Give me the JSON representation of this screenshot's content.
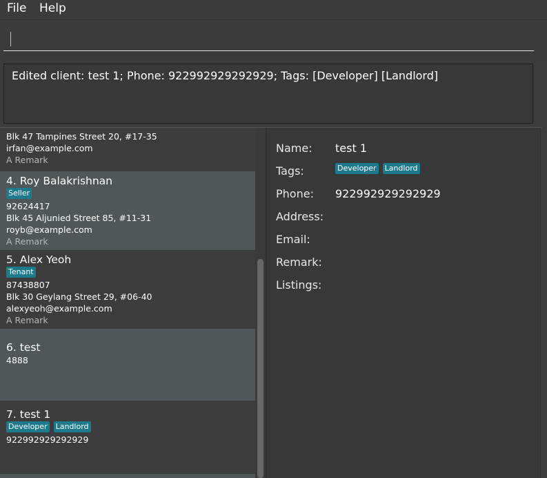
{
  "menu": {
    "file": "File",
    "help": "Help"
  },
  "command": {
    "value": "",
    "placeholder": ""
  },
  "result": {
    "text": "Edited client: test 1; Phone: 922992929292929; Tags: [Developer] [Landlord]"
  },
  "list": {
    "partial_card": {
      "address": "Blk 47 Tampines Street 20, #17-35",
      "email": "irfan@example.com",
      "remark": "A Remark"
    },
    "cards": [
      {
        "name": "4. Roy Balakrishnan",
        "tags": [
          "Seller"
        ],
        "phone": "92624417",
        "address": "Blk 45 Aljunied Street 85, #11-31",
        "email": "royb@example.com",
        "remark": "A Remark"
      },
      {
        "name": "5. Alex Yeoh",
        "tags": [
          "Tenant"
        ],
        "phone": "87438807",
        "address": "Blk 30 Geylang Street 29, #06-40",
        "email": "alexyeoh@example.com",
        "remark": "A Remark"
      },
      {
        "name": "6. test",
        "phone": "4888"
      },
      {
        "name": "7. test 1",
        "tags": [
          "Developer",
          "Landlord"
        ],
        "phone": "922992929292929"
      }
    ]
  },
  "detail": {
    "labels": {
      "name": "Name:",
      "tags": "Tags:",
      "phone": "Phone:",
      "address": "Address:",
      "email": "Email:",
      "remark": "Remark:",
      "listings": "Listings:"
    },
    "name": "test 1",
    "tags": [
      "Developer",
      "Landlord"
    ],
    "phone": "922992929292929"
  },
  "colors": {
    "tag": "#1d7a8c",
    "card_light": "#515658",
    "card_dark": "#3c3c3c"
  }
}
